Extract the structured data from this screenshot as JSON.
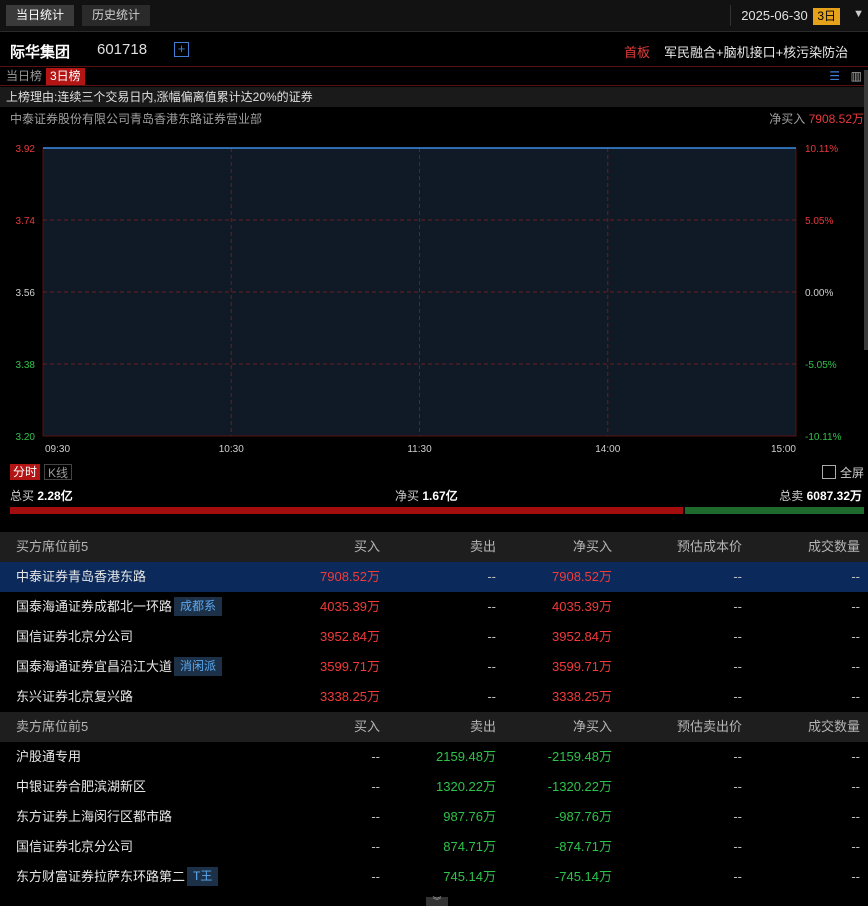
{
  "tabs": {
    "today": "当日统计",
    "history": "历史统计"
  },
  "date": {
    "value": "2025-06-30",
    "badge": "3日"
  },
  "stock": {
    "name": "际华集团",
    "code": "601718",
    "board": "首板",
    "concepts": "军民融合+脑机接口+核污染防治"
  },
  "periods": {
    "today": "当日榜",
    "three_day": "3日榜"
  },
  "reason": "上榜理由:连续三个交易日内,涨幅偏离值累计达20%的证券",
  "seat": {
    "name": "中泰证券股份有限公司青岛香港东路证券营业部",
    "net_label": "净买入",
    "net_value": "7908.52万"
  },
  "chart_data": {
    "type": "line",
    "y_left_ticks": [
      "3.92",
      "3.74",
      "3.56",
      "3.38",
      "3.20"
    ],
    "y_right_ticks": [
      "10.11%",
      "5.05%",
      "0.00%",
      "-5.05%",
      "-10.11%"
    ],
    "x_ticks": [
      "09:30",
      "10:30",
      "11:30",
      "14:00",
      "15:00"
    ],
    "ylim": [
      3.2,
      3.92
    ],
    "x": [
      "09:30",
      "15:00"
    ],
    "values": [
      3.92,
      3.92
    ],
    "grid": true
  },
  "chart_controls": {
    "intraday": "分时",
    "kline": "K线",
    "fullscreen": "全屏"
  },
  "totals": {
    "buy_label": "总买",
    "buy_value": "2.28亿",
    "net_label": "净买",
    "net_value": "1.67亿",
    "sell_label": "总卖",
    "sell_value": "6087.32万",
    "buy_ratio": 0.7896
  },
  "buy_table": {
    "headers": [
      "买方席位前5",
      "买入",
      "卖出",
      "净买入",
      "预估成本价",
      "成交数量"
    ],
    "rows": [
      {
        "name": "中泰证券青岛香港东路",
        "tag": "",
        "buy": "7908.52万",
        "sell": "--",
        "net": "7908.52万",
        "cost": "--",
        "vol": "--"
      },
      {
        "name": "国泰海通证券成都北一环路",
        "tag": "成都系",
        "buy": "4035.39万",
        "sell": "--",
        "net": "4035.39万",
        "cost": "--",
        "vol": "--"
      },
      {
        "name": "国信证券北京分公司",
        "tag": "",
        "buy": "3952.84万",
        "sell": "--",
        "net": "3952.84万",
        "cost": "--",
        "vol": "--"
      },
      {
        "name": "国泰海通证券宜昌沿江大道",
        "tag": "消闲派",
        "buy": "3599.71万",
        "sell": "--",
        "net": "3599.71万",
        "cost": "--",
        "vol": "--"
      },
      {
        "name": "东兴证券北京复兴路",
        "tag": "",
        "buy": "3338.25万",
        "sell": "--",
        "net": "3338.25万",
        "cost": "--",
        "vol": "--"
      }
    ]
  },
  "sell_table": {
    "headers": [
      "卖方席位前5",
      "买入",
      "卖出",
      "净买入",
      "预估卖出价",
      "成交数量"
    ],
    "rows": [
      {
        "name": "沪股通专用",
        "tag": "",
        "buy": "--",
        "sell": "2159.48万",
        "net": "-2159.48万",
        "cost": "--",
        "vol": "--"
      },
      {
        "name": "中银证券合肥滨湖新区",
        "tag": "",
        "buy": "--",
        "sell": "1320.22万",
        "net": "-1320.22万",
        "cost": "--",
        "vol": "--"
      },
      {
        "name": "东方证券上海闵行区都市路",
        "tag": "",
        "buy": "--",
        "sell": "987.76万",
        "net": "-987.76万",
        "cost": "--",
        "vol": "--"
      },
      {
        "name": "国信证券北京分公司",
        "tag": "",
        "buy": "--",
        "sell": "874.71万",
        "net": "-874.71万",
        "cost": "--",
        "vol": "--"
      },
      {
        "name": "东方财富证券拉萨东环路第二",
        "tag": "T王",
        "buy": "--",
        "sell": "745.14万",
        "net": "-745.14万",
        "cost": "--",
        "vol": "--"
      }
    ]
  }
}
